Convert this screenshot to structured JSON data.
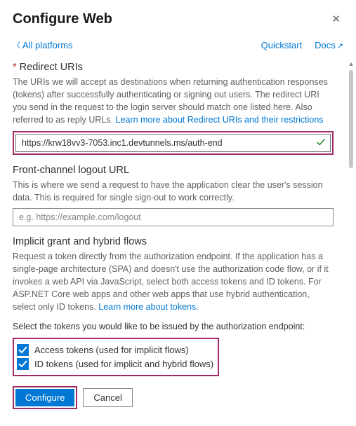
{
  "header": {
    "title": "Configure Web"
  },
  "topbar": {
    "back": "All platforms",
    "quickstart": "Quickstart",
    "docs": "Docs"
  },
  "redirect": {
    "heading": "Redirect URIs",
    "desc_pre": "The URIs we will accept as destinations when returning authentication responses (tokens) after successfully authenticating or signing out users. The redirect URI you send in the request to the login server should match one listed here. Also referred to as reply URLs. ",
    "learn": "Learn more about Redirect URIs and their restrictions",
    "value": "https://krw18vv3-7053.inc1.devtunnels.ms/auth-end"
  },
  "logout": {
    "heading": "Front-channel logout URL",
    "desc": "This is where we send a request to have the application clear the user's session data. This is required for single sign-out to work correctly.",
    "placeholder": "e.g. https://example.com/logout"
  },
  "implicit": {
    "heading": "Implicit grant and hybrid flows",
    "desc_pre": "Request a token directly from the authorization endpoint. If the application has a single-page architecture (SPA) and doesn't use the authorization code flow, or if it invokes a web API via JavaScript, select both access tokens and ID tokens. For ASP.NET Core web apps and other web apps that use hybrid authentication, select only ID tokens. ",
    "learn": "Learn more about tokens.",
    "select_text": "Select the tokens you would like to be issued by the authorization endpoint:",
    "access_label": "Access tokens (used for implicit flows)",
    "id_label": "ID tokens (used for implicit and hybrid flows)"
  },
  "footer": {
    "configure": "Configure",
    "cancel": "Cancel"
  }
}
